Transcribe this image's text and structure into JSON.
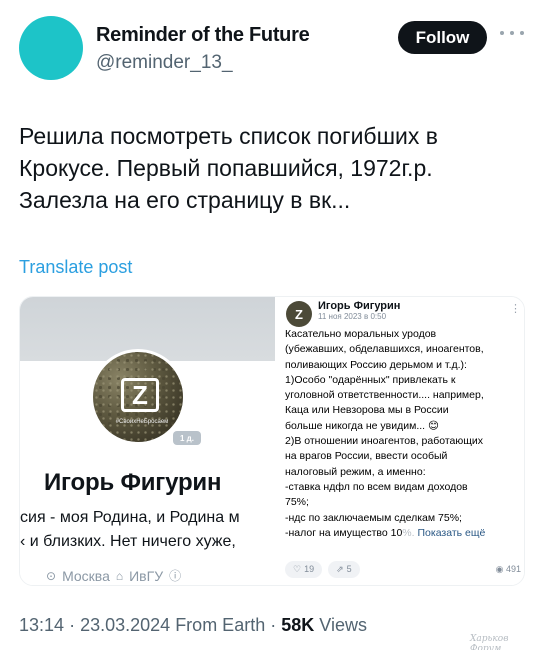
{
  "author": {
    "display_name": "Reminder of the Future",
    "handle": "@reminder_13_",
    "avatar_color": "#1dc4c8"
  },
  "follow_button": {
    "label": "Follow"
  },
  "post": {
    "text_lines": [
      "Решила посмотреть список погибших в",
      "Крокусе. Первый попавшийся, 1972г.р.",
      "Залезла на его страницу в вк..."
    ],
    "translate_label": "Translate post"
  },
  "media": {
    "profile": {
      "avatar_letter": "Z",
      "avatar_caption": "#СвоихНеБросаем",
      "badge": "1 д.",
      "name": "Игорь Фигурин",
      "bio_line1": "сия - моя Родина, и Родина м",
      "bio_line2": "‹ и близких. Нет ничего хуже,",
      "location": "Москва",
      "education": "ИвГУ"
    },
    "vk_post": {
      "author": "Игорь Фигурин",
      "date": "11 ноя 2023 в 0:50",
      "lines": [
        "Касательно моральных уродов",
        "(убежавших, обделавшихся, иноагентов,",
        "поливающих Россию дерьмом и т.д.):",
        "1)Особо \"одарённых\" привлекать к",
        "уголовной ответственности.... например,",
        "Каца или Невзорова мы в России",
        "больше никогда не увидим... 😊",
        "2)В отношении иноагентов, работающих",
        "на врагов России, ввести особый",
        "налоговый режим, а именно:",
        "-ставка ндфл по всем видам доходов",
        "75%;",
        "-ндс по заключаемым сделкам 75%;"
      ],
      "last_line": "-налог на имущество 10",
      "last_line_fade": "%.",
      "show_more": "Показать ещё",
      "likes": "19",
      "shares": "5",
      "views": "491"
    }
  },
  "meta": {
    "time": "13:14",
    "date": "23.03.2024",
    "source": "From Earth",
    "views_count": "58K",
    "views_label": "Views",
    "separator": "·"
  },
  "watermark": "Харьков Форум"
}
